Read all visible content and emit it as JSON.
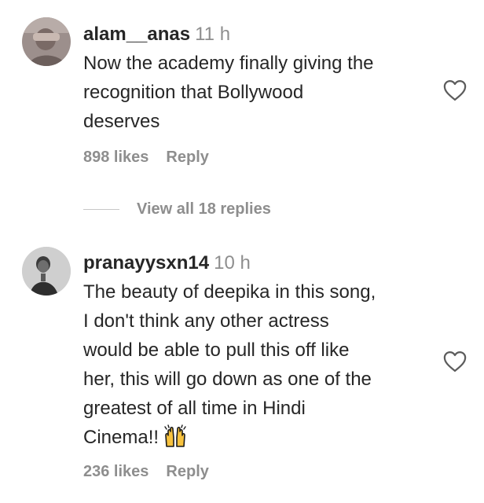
{
  "comments": [
    {
      "username": "alam__anas",
      "time": "11 h",
      "lines": [
        "Now the academy finally giving the",
        "recognition that Bollywood",
        "deserves"
      ],
      "likes": "898 likes",
      "reply": "Reply",
      "view_replies": "View all 18 replies",
      "avatar_icon": "user-avatar-icon",
      "like_icon": "heart-outline-icon"
    },
    {
      "username": "pranayysxn14",
      "time": "10 h",
      "lines": [
        "The beauty of deepika in this song,",
        "I don't think any other actress",
        "would be able to pull this off like",
        "her, this will go down as one of the",
        "greatest of all time in Hindi",
        "Cinema!!"
      ],
      "emoji_icon": "raising-hands-emoji-icon",
      "likes": "236 likes",
      "reply": "Reply",
      "avatar_icon": "user-avatar-icon",
      "like_icon": "heart-outline-icon"
    }
  ],
  "colors": {
    "text": "#262626",
    "secondary": "#8e8e8e",
    "divider": "#c7c7c7",
    "background": "#ffffff"
  }
}
